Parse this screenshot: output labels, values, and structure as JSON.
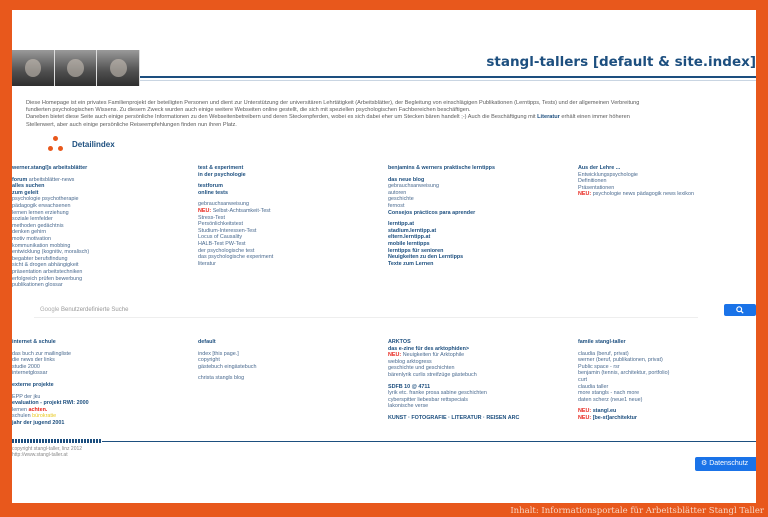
{
  "site_title": "stangl-tallers [default & site.index]",
  "intro": {
    "line1": "Diese Homepage ist ein privates Familienprojekt der beteiligten Personen und dient zur Unterstützung der universitären Lehrtätigkeit (Arbeitsblätter), der Begleitung von einschlägigen Publikationen (Lerntipps, Tests) und der allgemeinen Verbreitung",
    "line2": "fundierten psychologischen Wissens. Zu diesem Zweck wurden auch einige weitere Webseiten online gestellt, die sich mit speziellen psychologischen Fachbereichen beschäftigen.",
    "line3a": "Daneben bietet diese Seite auch einige persönliche Informationen zu den Webseitenbetreibern und deren Steckenpferden, wobei es sich dabei eher um Stecken bären handelt ;-) Auch die Beschäftigung mit",
    "line3b": "Literatur",
    "line3c": "erhält einen immer höheren",
    "line4": "Stellenwert, aber auch einige persönliche Reiseempfehlungen finden nun ihren Platz."
  },
  "detail_label": "Detailindex",
  "col1": {
    "heading": "werner.stangl]s arbeitsblätter",
    "b1": "forum",
    "t1": "arbeitsblätter-news",
    "b2": "alles suchen",
    "b3": "zum geleit",
    "items": [
      "psychologie psychotherapie",
      "pädagogik erwachsenen",
      "lernen lernen erziehung",
      "soziale lernfelder",
      "methoden gedächtnis",
      "denken gehirn",
      "motiv motivation",
      "kommunikation mobbing",
      "entwicklung (kognitiv, moralisch)",
      "begabter berufsfindung",
      "sicht & drogen abhängigkeit",
      "präsentation arbeitstechniken",
      "erfolgreich prüfen bewerbung",
      "publikationen glossar"
    ]
  },
  "col2": {
    "heading1": "test & experiment",
    "heading2": "in der psychologie",
    "b1": "testforum",
    "b2": "online tests",
    "items": [
      "gebrauchsanweisung",
      "Selbst-Achtsamkeit-Test",
      "Stress-Test",
      "Persönlichkeitstest",
      "Studium-Interessen-Test",
      "Locus of Causality",
      "HALB-Test PW-Test",
      "der psychologische test",
      "das psychologische experiment",
      "literatur"
    ],
    "new_label": "NEU:"
  },
  "col3": {
    "heading": "benjamins & werners praktische lerntipps",
    "b1": "das neue blog",
    "items1": [
      "gebrauchsanweisung",
      "autoren",
      "geschichte",
      "fernost"
    ],
    "b2": "Consejos prácticos para aprender",
    "links": [
      "lerntipp.at",
      "stadium.lerntipp.at",
      "eltern.lerntipp.at",
      "mobile lerntipps",
      "lerntipps für senioren",
      "Neuigkeiten zu den Lerntipps",
      "Texte zum Lernen"
    ]
  },
  "col4": {
    "heading": "Aus der Lehre ...",
    "items": [
      "Entwicklungspsychologie",
      "Definitionen",
      "Präsentationen"
    ],
    "new_item": "psychologie news pädagogik news lexikon"
  },
  "search": {
    "placeholder": "Benutzerdefinierte Suche",
    "brand": "Google",
    "button_icon": "search-icon"
  },
  "b_col1": {
    "heading": "internet & schule",
    "items": [
      "das buch zur mailingliste",
      "die news der links",
      "studie 2000",
      "internetglossar"
    ],
    "heading2": "externe projekte",
    "items2": [
      "EPP der jku",
      "evaluation - projekt RWI: 2000",
      "lernen",
      "achten.",
      "schulen",
      "bürokratie",
      "jahr der jugend 2001"
    ]
  },
  "b_col2": {
    "heading": "default",
    "items": [
      "index [this page.]",
      "copyright",
      "gästebuch eingästebuch"
    ],
    "item2": "christa stangls blog"
  },
  "b_col3": {
    "heading": "ARKTOS",
    "sub": "das e-zine für des arktophiden>",
    "new_item": "Neuigkeiten für Arktophile",
    "items": [
      "weblog arktogress",
      "geschichte und geschichten",
      "bärenlyrik curlis streifzüge gästebuch"
    ],
    "b2": "SDFB 10 @ 4711",
    "items2": [
      "lyrik etc. franke prosa sabine geschichten",
      "cyberspitter liebesbar rettspecials",
      "lakonische verse"
    ],
    "footer": "KUNST · FOTOGRAFIE · LITERATUR · REISEN ARC"
  },
  "b_col4": {
    "heading": "famile stangl-taller",
    "items": [
      "claudia (beruf, privat)",
      "werner (beruf, publikationen, privat)",
      "Public space - rsr",
      "benjamin (tennis, architektur, portfolio)",
      "curt",
      "claudia taller",
      "more stangls - nach more",
      "daten scherz (neue1 neue)"
    ],
    "new1": "stangl.eu",
    "new2": "[be-st]architektur"
  },
  "copyright": {
    "line1": "copyright stangl-taller, linz 2012",
    "line2": "http://www.stangl-taller.at"
  },
  "privacy_label": "Datenschutz",
  "caption": "Inhalt: Informationsportale für Arbeitsblätter Stangl Taller"
}
